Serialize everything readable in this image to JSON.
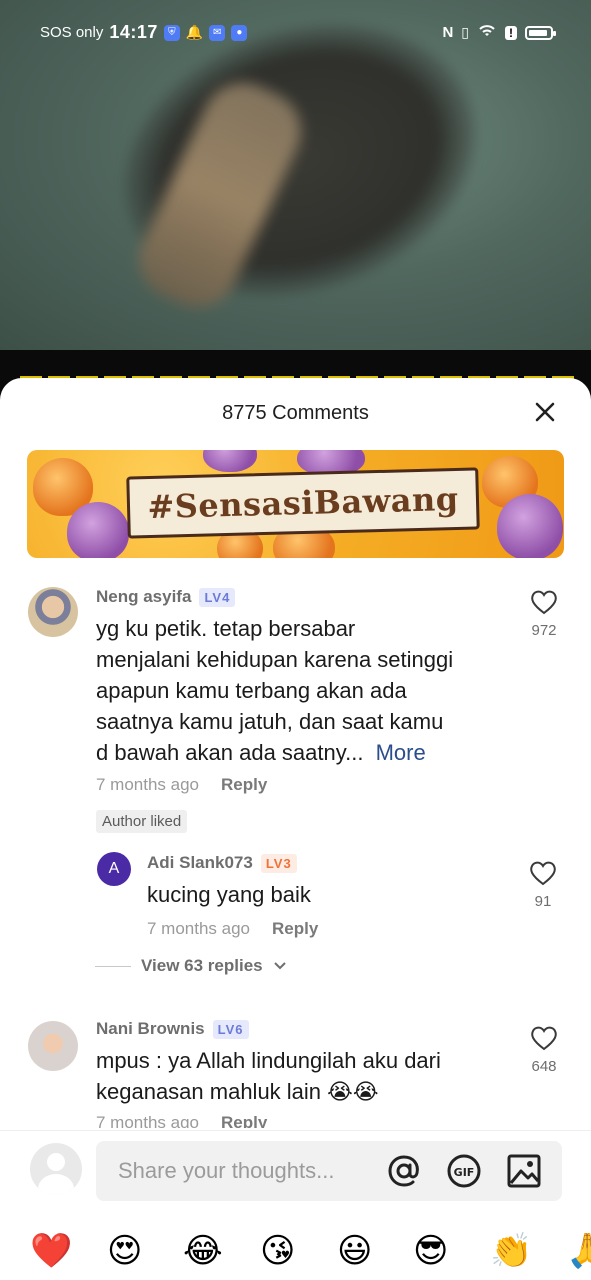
{
  "status_bar": {
    "network": "SOS only",
    "time": "14:17"
  },
  "sheet": {
    "title": "8775 Comments",
    "banner_text": "#SensasiBawang"
  },
  "comments": [
    {
      "username": "Neng asyifa",
      "level": "LV4",
      "text_lines": [
        "yg ku petik. tetap bersabar",
        "menjalani kehidupan karena setinggi",
        "apapun kamu terbang akan ada",
        "saatnya kamu jatuh, dan saat kamu",
        "d bawah akan ada saatny..."
      ],
      "more_label": "More",
      "time": "7 months ago",
      "reply_label": "Reply",
      "badge": "Author liked",
      "likes": "972",
      "replies": [
        {
          "avatar_letter": "A",
          "username": "Adi Slank073",
          "level": "LV3",
          "text": "kucing yang baik",
          "time": "7 months ago",
          "reply_label": "Reply",
          "likes": "91"
        }
      ],
      "view_replies_label": "View 63 replies"
    },
    {
      "username": "Nani Brownis",
      "level": "LV6",
      "text_lines": [
        "mpus : ya Allah lindungilah aku dari",
        "keganasan mahluk lain 😭😭"
      ],
      "time": "7 months ago",
      "reply_label": "Reply",
      "likes": "648"
    }
  ],
  "composer": {
    "placeholder": "Share your thoughts...",
    "icons": [
      "at-icon",
      "gif-icon",
      "image-icon"
    ]
  },
  "emoji_bar": [
    "❤️",
    "😍",
    "😂",
    "😘",
    "😃",
    "😎",
    "👏",
    "🙏"
  ],
  "colors": {
    "level_blue": "#6b7bd8",
    "level_orange": "#f07238",
    "more_link": "#2a4e8c"
  }
}
